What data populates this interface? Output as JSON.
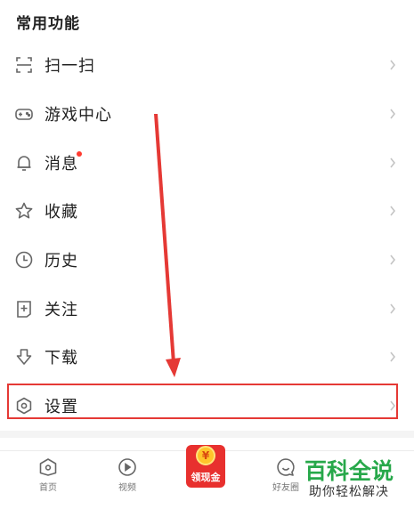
{
  "section": {
    "title": "常用功能"
  },
  "menu": {
    "items": [
      {
        "label": "扫一扫",
        "icon": "scan-icon",
        "name": "menu-item-scan"
      },
      {
        "label": "游戏中心",
        "icon": "gamepad-icon",
        "name": "menu-item-game-center"
      },
      {
        "label": "消息",
        "icon": "bell-icon",
        "name": "menu-item-messages",
        "badge": "red-dot"
      },
      {
        "label": "收藏",
        "icon": "star-icon",
        "name": "menu-item-favorites"
      },
      {
        "label": "历史",
        "icon": "clock-icon",
        "name": "menu-item-history"
      },
      {
        "label": "关注",
        "icon": "follow-icon",
        "name": "menu-item-following"
      },
      {
        "label": "下载",
        "icon": "download-icon",
        "name": "menu-item-download"
      },
      {
        "label": "设置",
        "icon": "settings-hexagon-icon",
        "name": "menu-item-settings"
      }
    ]
  },
  "tabbar": {
    "items": [
      {
        "label": "首页",
        "icon": "home-icon"
      },
      {
        "label": "视频",
        "icon": "play-icon"
      },
      {
        "label": "领现金",
        "icon": "coin-icon"
      },
      {
        "label": "好友圈",
        "icon": "chat-icon"
      }
    ]
  },
  "coin_symbol": "¥",
  "watermark": {
    "title": "百科全说",
    "subtitle": "助你轻松解决"
  },
  "colors": {
    "annotation_red": "#e53935",
    "badge_red": "#ff3b30",
    "cash_red": "#e8302e",
    "watermark_green": "#27a84a",
    "icon_gray": "#666666"
  }
}
